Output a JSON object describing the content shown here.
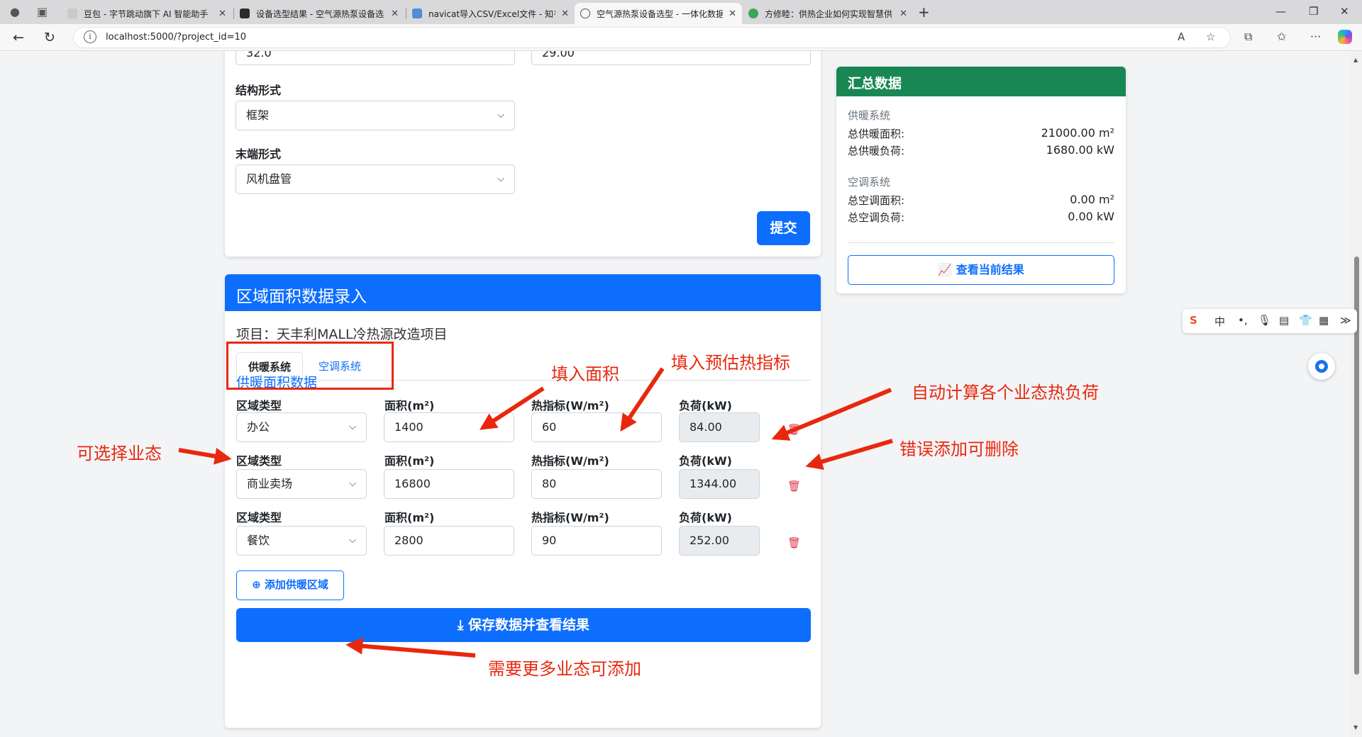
{
  "browser": {
    "tabs": [
      {
        "title": "豆包 - 字节跳动旗下 AI 智能助手",
        "fav_color": "#c9c9c9"
      },
      {
        "title": "设备选型结果 - 空气源热泵设备选",
        "fav_color": "#2b2b2b"
      },
      {
        "title": "navicat导入CSV/Excel文件 - 知乎",
        "fav_color": "#4f8dd6"
      },
      {
        "title": "空气源热泵设备选型 - 一体化数据",
        "fav_color": "#666666"
      },
      {
        "title": "方修睦：供热企业如何实现智慧供",
        "fav_color": "#3ba55c"
      }
    ],
    "close_glyph": "✕",
    "url": "localhost:5000/?project_id=10"
  },
  "upper_form": {
    "field1_partial": "32.0",
    "field2_partial": "29.00",
    "structure_label": "结构形式",
    "structure_value": "框架",
    "terminal_label": "末端形式",
    "terminal_value": "风机盘管",
    "submit_label": "提交"
  },
  "region_card": {
    "title": "区域面积数据录入",
    "project_line": "项目：天丰利MALL冷热源改造项目",
    "tab_heating": "供暖系统",
    "tab_ac": "空调系统",
    "section_title": "供暖面积数据",
    "col_type": "区域类型",
    "col_area": "面积(m²)",
    "col_index": "热指标(W/m²)",
    "col_load": "负荷(kW)",
    "rows": [
      {
        "type": "办公",
        "area": "1400",
        "index": "60",
        "load": "84.00"
      },
      {
        "type": "商业卖场",
        "area": "16800",
        "index": "80",
        "load": "1344.00"
      },
      {
        "type": "餐饮",
        "area": "2800",
        "index": "90",
        "load": "252.00"
      }
    ],
    "add_label": "添加供暖区域",
    "save_label": "保存数据并查看结果"
  },
  "summary": {
    "title": "汇总数据",
    "heating_title": "供暖系统",
    "heating_area_label": "总供暖面积:",
    "heating_area_value": "21000.00 m²",
    "heating_load_label": "总供暖负荷:",
    "heating_load_value": "1680.00 kW",
    "ac_title": "空调系统",
    "ac_area_label": "总空调面积:",
    "ac_area_value": "0.00 m²",
    "ac_load_label": "总空调负荷:",
    "ac_load_value": "0.00 kW",
    "view_label": "查看当前结果"
  },
  "annotations": {
    "select_type": "可选择业态",
    "fill_area": "填入面积",
    "fill_index": "填入预估热指标",
    "auto_calc": "自动计算各个业态热负荷",
    "delete": "错误添加可删除",
    "add_more": "需要更多业态可添加"
  },
  "colors": {
    "primary": "#0d6efd",
    "summary_header": "#198754",
    "annotation": "#e8280e",
    "danger": "#dc3545"
  }
}
